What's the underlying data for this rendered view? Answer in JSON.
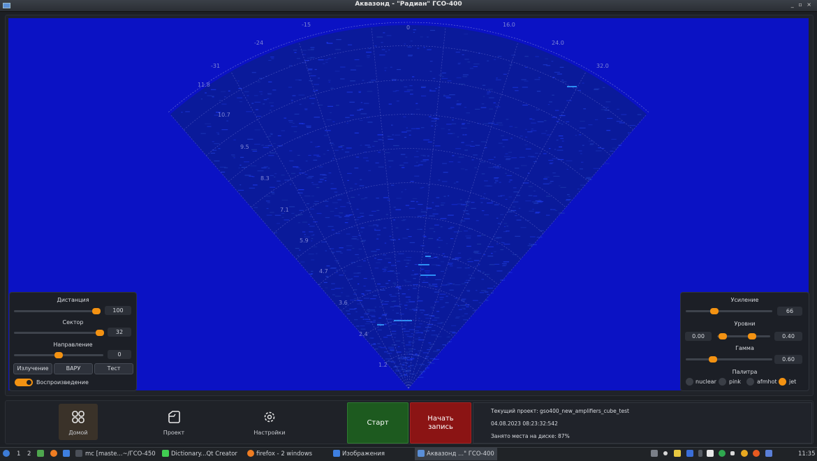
{
  "window": {
    "title": "Аквазонд  - \"Радиан\" ГСО-400",
    "controls": "_ ▫ ×"
  },
  "sonar": {
    "angle_labels": [
      "-31",
      "-24",
      "-15",
      "0",
      "16.0",
      "24.0",
      "32.0"
    ],
    "range_labels": [
      "11.8",
      "10.7",
      "9.5",
      "8.3",
      "7.1",
      "5.9",
      "4.7",
      "3.6",
      "2.4",
      "1.2"
    ]
  },
  "left_panel": {
    "distance": {
      "label": "Дистанция",
      "value": "100"
    },
    "sector": {
      "label": "Сектор",
      "value": "32"
    },
    "direction": {
      "label": "Направление",
      "value": "0"
    },
    "buttons": {
      "emission": "Излучение",
      "varu": "ВАРУ",
      "test": "Тест"
    },
    "playback": {
      "label": "Воспроизведение",
      "on": true
    }
  },
  "right_panel": {
    "gain": {
      "label": "Усиление",
      "value": "66"
    },
    "levels": {
      "label": "Уровни",
      "min": "0.00",
      "max": "0.40"
    },
    "gamma": {
      "label": "Гамма",
      "value": "0.60"
    },
    "palette": {
      "label": "Палитра",
      "options": [
        "nuclear",
        "pink",
        "afmhot",
        "jet"
      ],
      "selected": "jet"
    }
  },
  "nav": {
    "home": "Домой",
    "project": "Проект",
    "settings": "Настройки"
  },
  "actions": {
    "start": "Старт",
    "record": "Начать запись"
  },
  "info": {
    "project": "Текущий проект: gso400_new_amplifiers_cube_test",
    "datetime": "04.08.2023  08:23:32:542",
    "disk": "Занято места на диске: 87%"
  },
  "taskbar": {
    "workspaces": [
      "1",
      "2"
    ],
    "items": [
      "mc [maste...~/ГСО-450",
      "Dictionary...Qt Creator",
      "firefox - 2 windows",
      "Изображения",
      "Аквазонд ...\" ГСО-400"
    ],
    "clock": "11:35"
  },
  "colors": {
    "accent": "#f39212",
    "sonar_bg": "#0b12c4",
    "start": "#1d5a1f",
    "record": "#8b1414"
  }
}
